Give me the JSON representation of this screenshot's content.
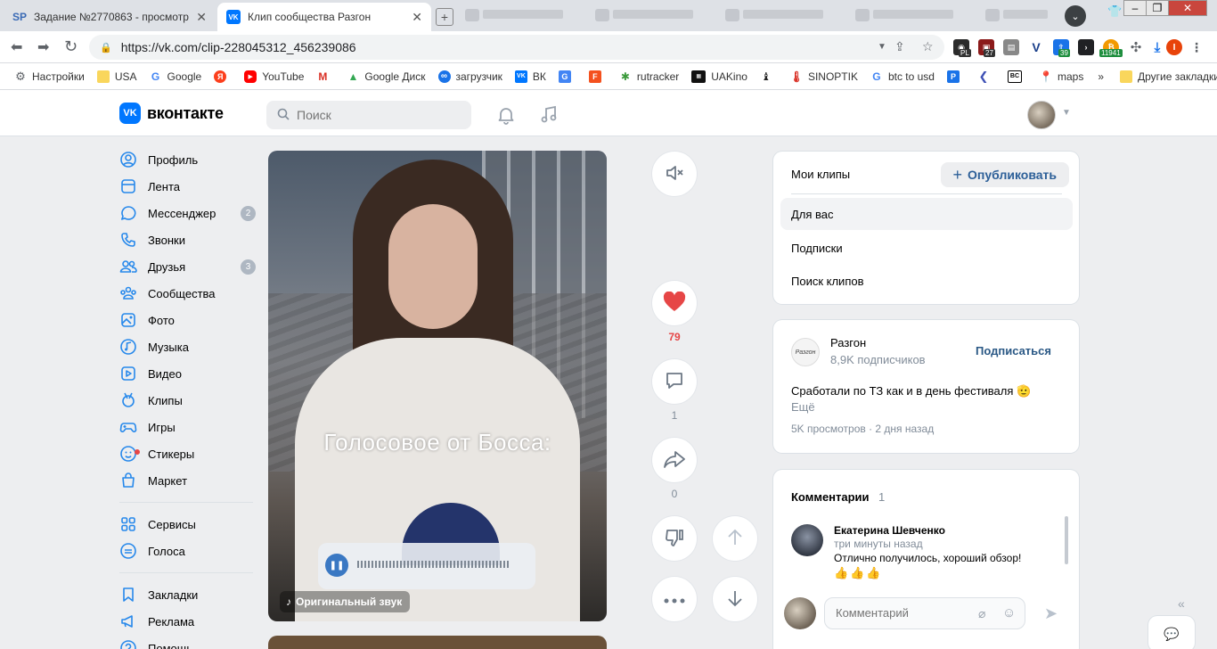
{
  "browser": {
    "tabs": [
      {
        "title": "Задание №2770863 - просмотр з",
        "favicon": "SP"
      },
      {
        "title": "Клип сообщества Разгон",
        "favicon": "VK"
      }
    ],
    "url": "https://vk.com/clip-228045312_456239086",
    "profile_letter": "I",
    "ext_badges": {
      "pl": "PL",
      "n27": "27",
      "n39": "39",
      "n11941": "11941"
    },
    "bookmarks": [
      {
        "label": "Настройки",
        "icon": "gear-icon"
      },
      {
        "label": "USA",
        "icon": "folder-icon"
      },
      {
        "label": "Google",
        "icon": "google-icon"
      },
      {
        "label": "",
        "icon": "yandex-icon"
      },
      {
        "label": "YouTube",
        "icon": "youtube-icon"
      },
      {
        "label": "",
        "icon": "gmail-icon"
      },
      {
        "label": "Google Диск",
        "icon": "drive-icon"
      },
      {
        "label": "загрузчик",
        "icon": "loop-icon"
      },
      {
        "label": "ВК",
        "icon": "vk-icon"
      },
      {
        "label": "",
        "icon": "translate-icon"
      },
      {
        "label": "",
        "icon": "f-icon"
      },
      {
        "label": "rutracker",
        "icon": "rutracker-icon"
      },
      {
        "label": "UAKino",
        "icon": "uakino-icon"
      },
      {
        "label": "",
        "icon": "chess-icon"
      },
      {
        "label": "SINOPTIK",
        "icon": "thermometer-icon"
      },
      {
        "label": "btc to usd",
        "icon": "google-icon"
      },
      {
        "label": "",
        "icon": "p-icon"
      },
      {
        "label": "",
        "icon": "arrow-icon"
      },
      {
        "label": "",
        "icon": "bc-icon"
      },
      {
        "label": "maps",
        "icon": "maps-icon"
      }
    ],
    "more_bookmarks": "»",
    "other_bookmarks": "Другие закладки"
  },
  "vk": {
    "logo": "вконтакте",
    "search_placeholder": "Поиск",
    "nav": [
      {
        "label": "Профиль",
        "icon": "profile-icon"
      },
      {
        "label": "Лента",
        "icon": "feed-icon"
      },
      {
        "label": "Мессенджер",
        "icon": "messenger-icon",
        "count": "2"
      },
      {
        "label": "Звонки",
        "icon": "phone-icon"
      },
      {
        "label": "Друзья",
        "icon": "friends-icon",
        "count": "3"
      },
      {
        "label": "Сообщества",
        "icon": "groups-icon"
      },
      {
        "label": "Фото",
        "icon": "photo-icon"
      },
      {
        "label": "Музыка",
        "icon": "music-icon"
      },
      {
        "label": "Видео",
        "icon": "video-icon"
      },
      {
        "label": "Клипы",
        "icon": "clips-icon"
      },
      {
        "label": "Игры",
        "icon": "games-icon"
      },
      {
        "label": "Стикеры",
        "icon": "stickers-icon"
      },
      {
        "label": "Маркет",
        "icon": "market-icon"
      }
    ],
    "nav2": [
      {
        "label": "Сервисы",
        "icon": "services-icon"
      },
      {
        "label": "Голоса",
        "icon": "votes-icon"
      }
    ],
    "nav3": [
      {
        "label": "Закладки",
        "icon": "bookmarks-icon"
      },
      {
        "label": "Реклама",
        "icon": "ads-icon"
      },
      {
        "label": "Помощь",
        "icon": "help-icon"
      }
    ]
  },
  "clip": {
    "caption": "Голосовое от Босса:",
    "sound_label": "Оригинальный звук",
    "likes": "79",
    "comments": "1",
    "shares": "0"
  },
  "menu": {
    "title": "Мои клипы",
    "publish": "Опубликовать",
    "items": [
      "Для вас",
      "Подписки",
      "Поиск клипов"
    ]
  },
  "author": {
    "avatar_text": "Разгон",
    "name": "Разгон",
    "subscribers": "8,9K подписчиков",
    "subscribe": "Подписаться",
    "description": "Сработали по ТЗ как и в день фестиваля 🫡",
    "more": "Ещё",
    "meta": "5K просмотров · 2 дня назад"
  },
  "comments": {
    "title": "Комментарии",
    "count": "1",
    "items": [
      {
        "name": "Екатерина Шевченко",
        "time": "три минуты назад",
        "text": "Отлично получилось, хороший обзор!",
        "emoji": "👍👍👍"
      }
    ],
    "input_placeholder": "Комментарий"
  },
  "colors": {
    "accent": "#0077ff",
    "link": "#2a5885",
    "like": "#e64646"
  }
}
